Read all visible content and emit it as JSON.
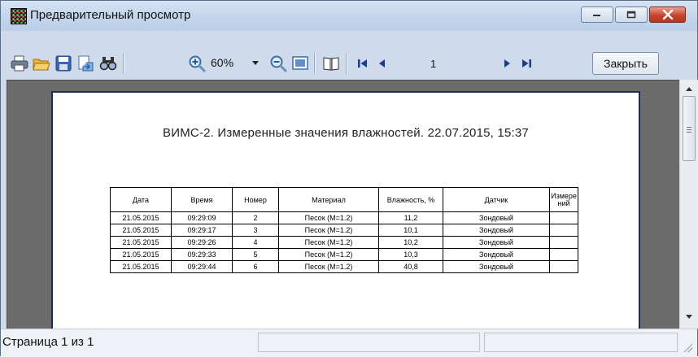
{
  "window": {
    "title": "Предварительный просмотр"
  },
  "toolbar": {
    "zoom_value": "60%",
    "page_number": "1",
    "close_label": "Закрыть",
    "icons": [
      "print-icon",
      "open-folder-icon",
      "save-icon",
      "export-icon",
      "find-icon",
      "zoom-in-icon",
      "zoom-out-icon",
      "page-width-icon",
      "book-icon",
      "first-page-icon",
      "prev-page-icon",
      "next-page-icon",
      "last-page-icon"
    ]
  },
  "report": {
    "title": "ВИМС-2. Измеренные значения влажностей.  22.07.2015, 15:37",
    "columns": [
      "Дата",
      "Время",
      "Номер",
      "Материал",
      "Влажность, %",
      "Датчик",
      "Измерений"
    ],
    "rows": [
      [
        "21.05.2015",
        "09:29:09",
        "2",
        "Песок (М=1.2)",
        "11,2",
        "Зондовый",
        ""
      ],
      [
        "21.05.2015",
        "09:29:17",
        "3",
        "Песок (М=1.2)",
        "10,1",
        "Зондовый",
        ""
      ],
      [
        "21.05.2015",
        "09:29:26",
        "4",
        "Песок (М=1.2)",
        "10,2",
        "Зондовый",
        ""
      ],
      [
        "21.05.2015",
        "09:29:33",
        "5",
        "Песок (М=1.2)",
        "10,3",
        "Зондовый",
        ""
      ],
      [
        "21.05.2015",
        "09:29:44",
        "6",
        "Песок (М=1.2)",
        "40,8",
        "Зондовый",
        ""
      ]
    ]
  },
  "status": {
    "page_info": "Страница 1 из 1"
  },
  "colors": {
    "titlebar": "#c4d5eb",
    "preview_background": "#6b6b6b",
    "page_border": "#1c2a5c",
    "close_button": "#c8442b"
  }
}
